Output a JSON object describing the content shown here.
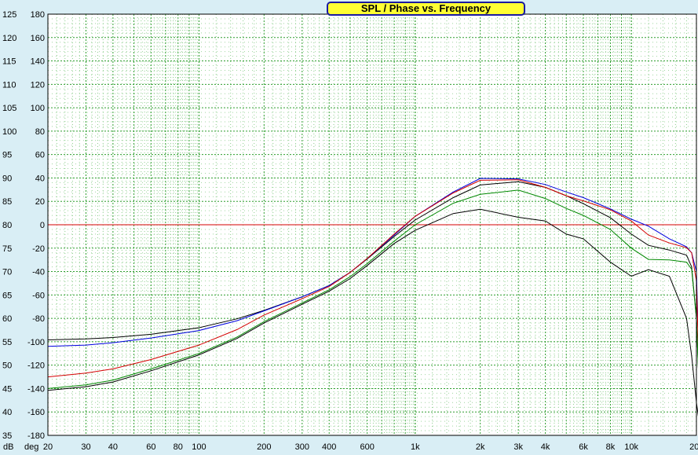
{
  "chart_data": {
    "type": "line",
    "title": "SPL / Phase vs. Frequency",
    "x_scale": "log",
    "xlim": [
      20,
      20000
    ],
    "ylim_spl": [
      35,
      125
    ],
    "ylim_phase": [
      -180,
      180
    ],
    "grid": true,
    "spl_unit_label": "dB",
    "phase_unit_label": "deg",
    "spl_ticks": [
      "125",
      "120",
      "115",
      "110",
      "105",
      "100",
      "95",
      "90",
      "85",
      "80",
      "75",
      "70",
      "65",
      "60",
      "55",
      "50",
      "45",
      "40",
      "35"
    ],
    "phase_ticks": [
      "180",
      "160",
      "140",
      "120",
      "100",
      "80",
      "60",
      "40",
      "20",
      "0",
      "-20",
      "-40",
      "-60",
      "-80",
      "-100",
      "-120",
      "-140",
      "-160",
      "-180"
    ],
    "x_ticks": [
      {
        "value": 20,
        "label": "20"
      },
      {
        "value": 30,
        "label": "30"
      },
      {
        "value": 40,
        "label": "40"
      },
      {
        "value": 60,
        "label": "60"
      },
      {
        "value": 80,
        "label": "80"
      },
      {
        "value": 100,
        "label": "100"
      },
      {
        "value": 200,
        "label": "200"
      },
      {
        "value": 300,
        "label": "300"
      },
      {
        "value": 400,
        "label": "400"
      },
      {
        "value": 600,
        "label": "600"
      },
      {
        "value": 1000,
        "label": "1k"
      },
      {
        "value": 2000,
        "label": "2k"
      },
      {
        "value": 3000,
        "label": "3k"
      },
      {
        "value": 4000,
        "label": "4k"
      },
      {
        "value": 6000,
        "label": "6k"
      },
      {
        "value": 8000,
        "label": "8k"
      },
      {
        "value": 10000,
        "label": "10k"
      },
      {
        "value": 20000,
        "label": "20k"
      }
    ],
    "reference_line": {
      "phase": 0,
      "color": "#d40000"
    },
    "x": [
      20,
      30,
      40,
      60,
      100,
      150,
      200,
      300,
      400,
      500,
      600,
      800,
      1000,
      1500,
      2000,
      3000,
      4000,
      5000,
      6000,
      8000,
      10000,
      12000,
      15000,
      18000,
      19000,
      20000,
      21000
    ],
    "series": [
      {
        "color": "#000000",
        "values": [
          55.4,
          55.6,
          55.9,
          56.6,
          58.0,
          59.9,
          61.7,
          64.6,
          67.0,
          69.8,
          72.7,
          77.5,
          81.0,
          85.8,
          88.5,
          89.2,
          88.0,
          86.2,
          84.5,
          81.5,
          78.0,
          75.6,
          74.6,
          73.5,
          71.0,
          60.0,
          35.0
        ]
      },
      {
        "color": "#0000e0",
        "values": [
          54.0,
          54.3,
          54.8,
          55.8,
          57.4,
          59.5,
          61.6,
          64.6,
          67.0,
          69.8,
          72.8,
          77.8,
          81.8,
          87.0,
          89.9,
          89.8,
          88.6,
          87.0,
          85.8,
          83.4,
          81.2,
          79.7,
          77.0,
          75.3,
          74.0,
          70.0,
          35.0
        ]
      },
      {
        "color": "#d40000",
        "values": [
          47.5,
          48.3,
          49.2,
          51.2,
          54.3,
          57.6,
          60.7,
          64.2,
          66.8,
          69.8,
          72.8,
          78.0,
          81.8,
          86.8,
          89.5,
          89.6,
          88.0,
          86.2,
          85.1,
          83.2,
          80.8,
          77.8,
          76.1,
          75.1,
          74.0,
          68.0,
          35.0
        ]
      },
      {
        "color": "#008800",
        "values": [
          45.0,
          45.8,
          46.8,
          49.2,
          52.5,
          56.0,
          59.3,
          63.3,
          66.1,
          68.9,
          71.7,
          76.5,
          80.0,
          84.6,
          86.5,
          87.4,
          85.6,
          83.5,
          82.0,
          79.0,
          75.0,
          72.6,
          72.5,
          72.0,
          70.5,
          60.0,
          35.0
        ]
      },
      {
        "color": "#000000",
        "values": [
          44.6,
          45.4,
          46.4,
          48.8,
          52.2,
          55.7,
          59.0,
          63.0,
          65.8,
          68.5,
          71.3,
          76.0,
          78.8,
          82.4,
          83.3,
          81.6,
          80.8,
          78.0,
          77.0,
          72.0,
          69.0,
          70.4,
          69.0,
          60.0,
          52.0,
          42.0,
          35.0
        ]
      }
    ]
  }
}
